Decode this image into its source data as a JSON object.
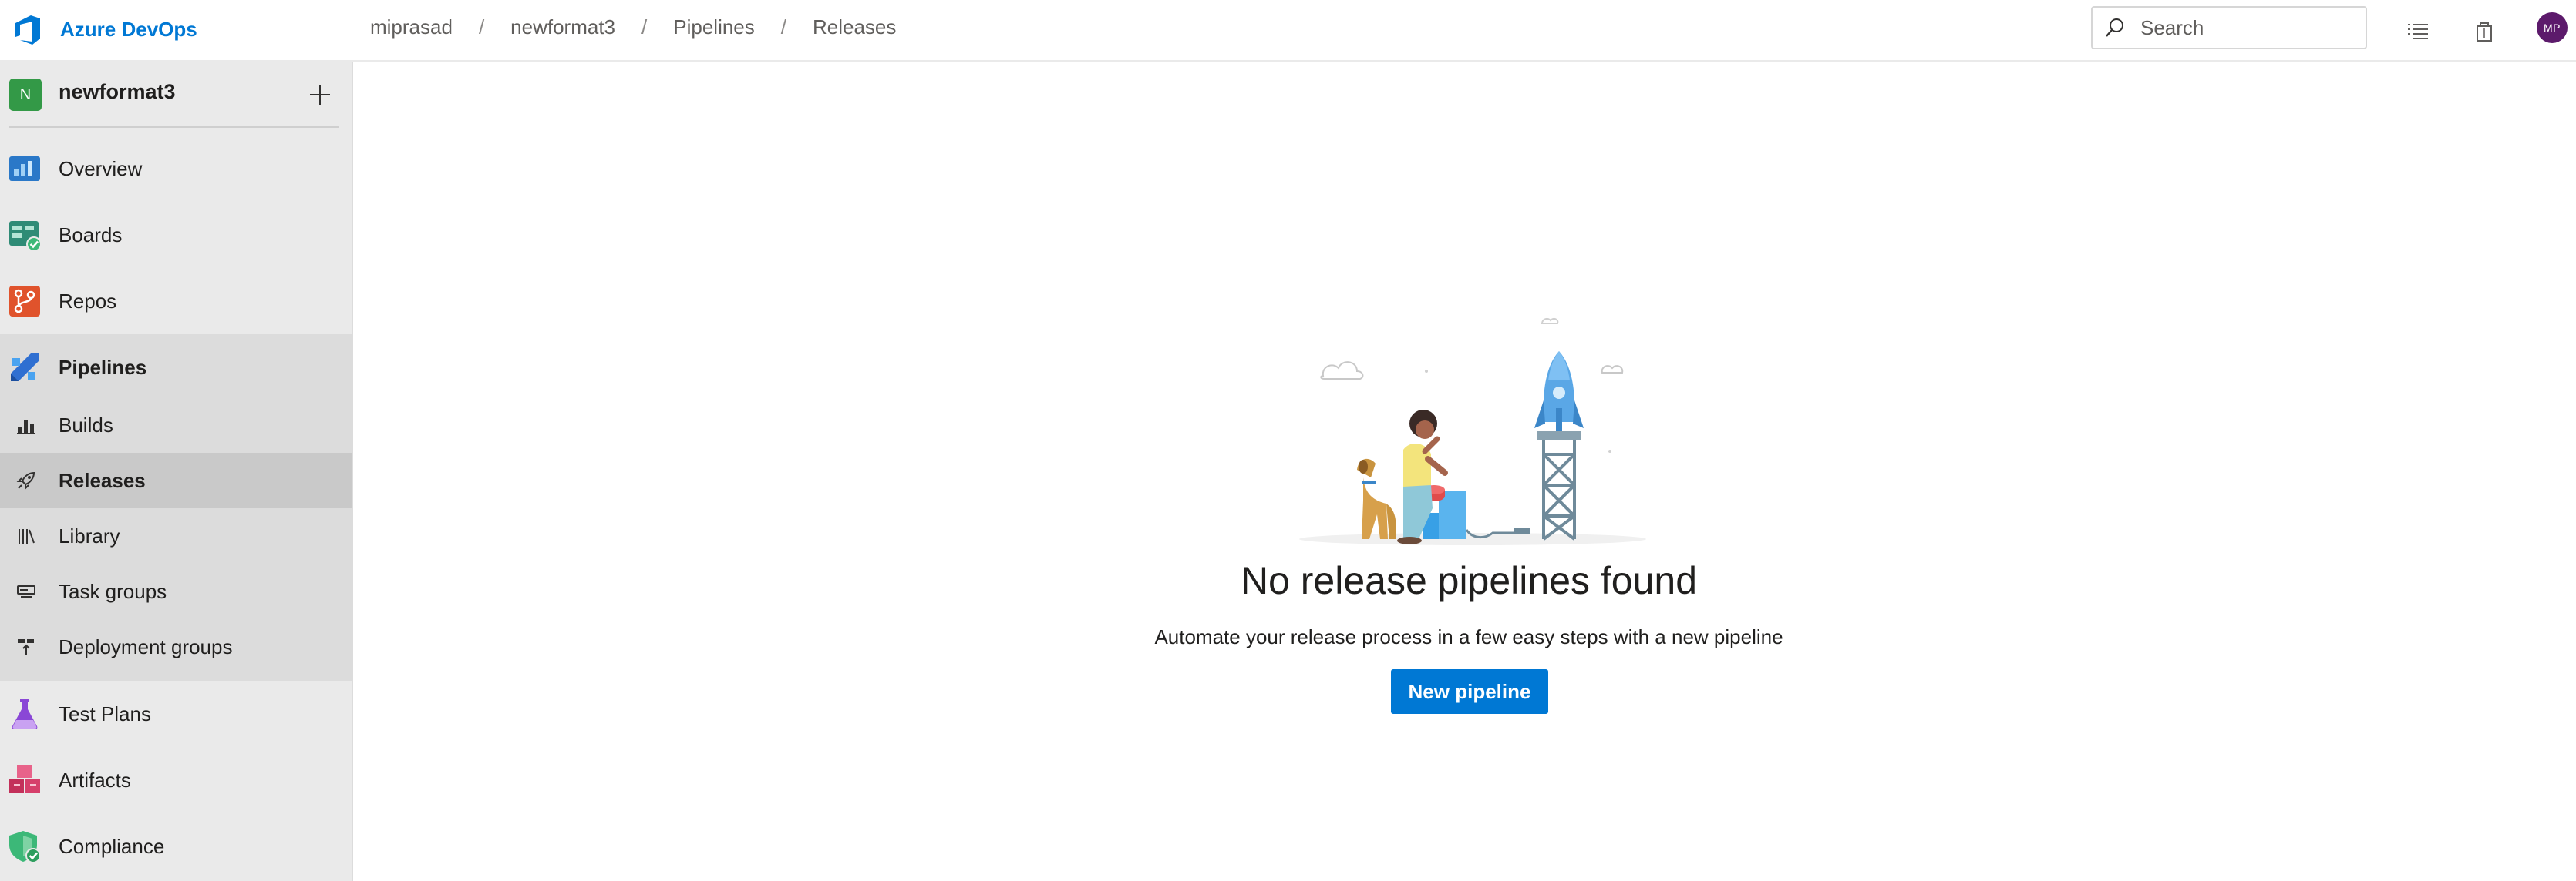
{
  "app": {
    "name": "Azure DevOps"
  },
  "breadcrumb": [
    "miprasad",
    "newformat3",
    "Pipelines",
    "Releases"
  ],
  "breadcrumb_separator": "/",
  "search": {
    "placeholder": "Search"
  },
  "user": {
    "initials": "MP"
  },
  "project": {
    "initial": "N",
    "name": "newformat3"
  },
  "nav": {
    "overview": "Overview",
    "boards": "Boards",
    "repos": "Repos",
    "pipelines": "Pipelines",
    "builds": "Builds",
    "releases": "Releases",
    "library": "Library",
    "task_groups": "Task groups",
    "deployment_groups": "Deployment groups",
    "test_plans": "Test Plans",
    "artifacts": "Artifacts",
    "compliance": "Compliance"
  },
  "empty_state": {
    "title": "No release pipelines found",
    "description": "Automate your release process in a few easy steps with a new pipeline",
    "button_label": "New pipeline"
  },
  "colors": {
    "brand": "#0078d4",
    "project_badge": "#339947",
    "avatar": "#5c1a6b",
    "sidebar_bg": "#eaeaea",
    "selected_bg": "#c9c9c9"
  }
}
